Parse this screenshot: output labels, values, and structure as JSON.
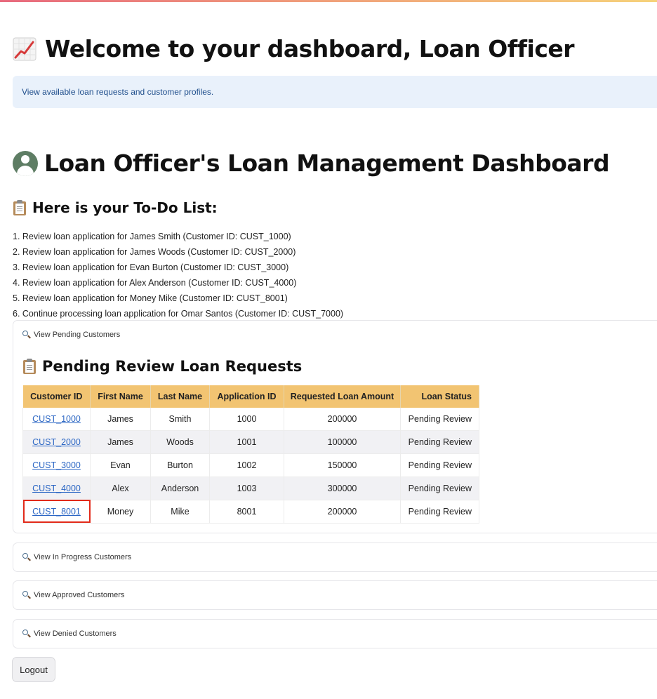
{
  "header": {
    "title": "Welcome to your dashboard, Loan Officer",
    "icon": "chart-increasing-icon"
  },
  "info_banner": "View available loan requests and customer profiles.",
  "dashboard": {
    "title": "Loan Officer's Loan Management Dashboard",
    "icon": "user-avatar-icon"
  },
  "todo": {
    "title": "Here is your To-Do List:",
    "items": [
      "1. Review loan application for James Smith (Customer ID: CUST_1000)",
      "2. Review loan application for James Woods (Customer ID: CUST_2000)",
      "3. Review loan application for Evan Burton (Customer ID: CUST_3000)",
      "4. Review loan application for Alex Anderson (Customer ID: CUST_4000)",
      "5. Review loan application for Money Mike (Customer ID: CUST_8001)",
      "6. Continue processing loan application for Omar Santos (Customer ID: CUST_7000)"
    ]
  },
  "expanders": {
    "pending": "View Pending Customers",
    "in_progress": "View In Progress Customers",
    "approved": "View Approved Customers",
    "denied": "View Denied Customers"
  },
  "pending_section": {
    "title": "Pending Review Loan Requests",
    "columns": [
      "Customer ID",
      "First Name",
      "Last Name",
      "Application ID",
      "Requested Loan Amount",
      "Loan Status"
    ],
    "rows": [
      [
        "CUST_1000",
        "James",
        "Smith",
        "1000",
        "200000",
        "Pending Review"
      ],
      [
        "CUST_2000",
        "James",
        "Woods",
        "1001",
        "100000",
        "Pending Review"
      ],
      [
        "CUST_3000",
        "Evan",
        "Burton",
        "1002",
        "150000",
        "Pending Review"
      ],
      [
        "CUST_4000",
        "Alex",
        "Anderson",
        "1003",
        "300000",
        "Pending Review"
      ],
      [
        "CUST_8001",
        "Money",
        "Mike",
        "8001",
        "200000",
        "Pending Review"
      ]
    ]
  },
  "logout_label": "Logout",
  "colors": {
    "table_header": "#f2c472",
    "info_bg": "#e9f1fb",
    "link": "#2b66c4",
    "highlight": "#e22a1a"
  }
}
